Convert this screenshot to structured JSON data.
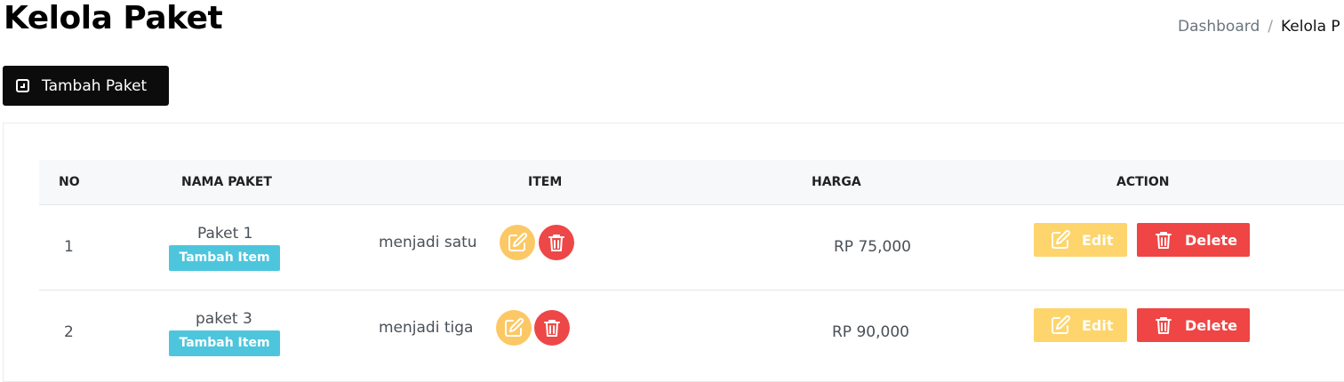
{
  "header": {
    "title": "Kelola Paket",
    "breadcrumb": {
      "home": "Dashboard",
      "separator": "/",
      "current": "Kelola P"
    }
  },
  "toolbar": {
    "add_label": "Tambah Paket"
  },
  "table": {
    "columns": {
      "no": "NO",
      "name": "NAMA PAKET",
      "item": "ITEM",
      "price": "HARGA",
      "action": "ACTION"
    },
    "rows": [
      {
        "no": "1",
        "name": "Paket 1",
        "add_item_label": "Tambah Item",
        "item": "menjadi satu",
        "price": "RP 75,000",
        "edit_label": "Edit",
        "delete_label": "Delete"
      },
      {
        "no": "2",
        "name": "paket 3",
        "add_item_label": "Tambah Item",
        "item": "menjadi tiga",
        "price": "RP 90,000",
        "edit_label": "Edit",
        "delete_label": "Delete"
      }
    ]
  },
  "colors": {
    "primary_button": "#0c0c0c",
    "badge": "#4dc6dd",
    "edit": "#fdd56c",
    "delete": "#ef4545"
  },
  "icons": {
    "add": "plus-square-icon",
    "edit": "pencil-square-icon",
    "delete": "trash-icon"
  }
}
